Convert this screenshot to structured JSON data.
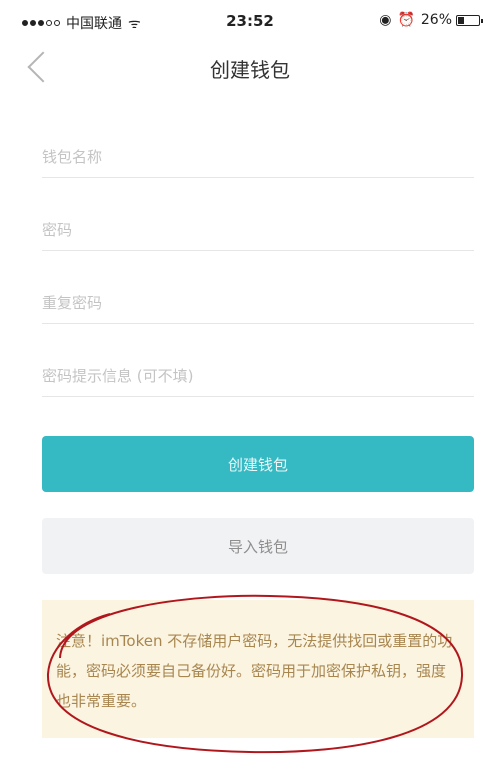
{
  "status_bar": {
    "signal_dots": [
      true,
      true,
      true,
      false,
      false
    ],
    "carrier": "中国联通",
    "wifi_glyph": "ᯤ",
    "time": "23:52",
    "location_glyph": "◉",
    "alarm_glyph": "⏰",
    "battery_text": "26%",
    "battery_level": 0.26
  },
  "nav": {
    "title": "创建钱包",
    "back_icon": "chevron-left-icon"
  },
  "form": {
    "wallet_name": {
      "value": "",
      "placeholder": "钱包名称"
    },
    "password": {
      "value": "",
      "placeholder": "密码"
    },
    "repeat_password": {
      "value": "",
      "placeholder": "重复密码"
    },
    "password_hint": {
      "value": "",
      "placeholder": "密码提示信息 (可不填)"
    }
  },
  "buttons": {
    "create": "创建钱包",
    "import": "导入钱包"
  },
  "notice": {
    "text": "注意！imToken 不存储用户密码，无法提供找回或重置的功能，密码必须要自己备份好。密码用于加密保护私钥，强度也非常重要。"
  },
  "colors": {
    "primary": "#35b9c2",
    "secondary_bg": "#f1f2f3",
    "notice_bg": "#fbf4e1",
    "notice_text": "#a8864f",
    "annotation": "#b0171d"
  }
}
